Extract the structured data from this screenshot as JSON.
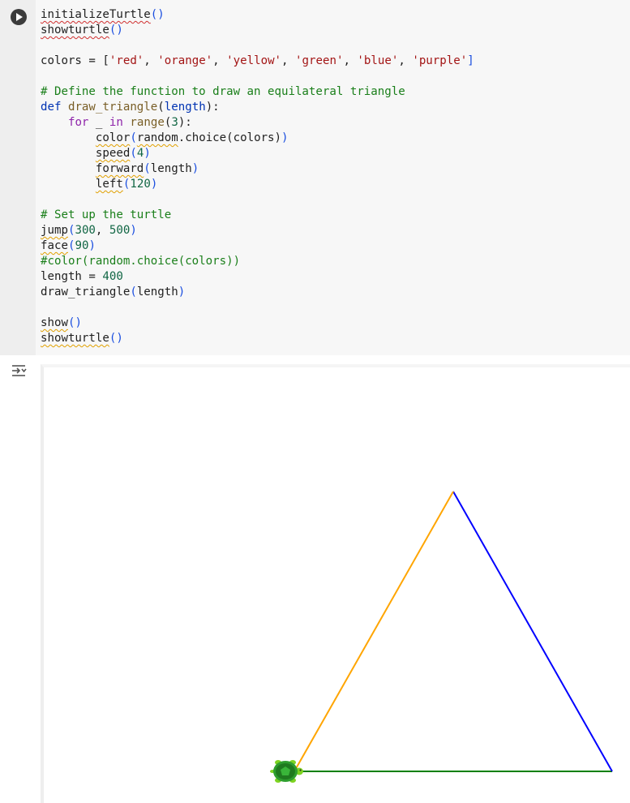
{
  "code_cell": {
    "run_button_label": "Run cell",
    "lines": [
      [
        {
          "t": "initializeTurtle",
          "c": "sqr"
        },
        {
          "t": "()",
          "c": "pr"
        }
      ],
      [
        {
          "t": "showturtle",
          "c": "sqr"
        },
        {
          "t": "()",
          "c": "pr"
        }
      ],
      [],
      [
        {
          "t": "colors = [",
          "c": ""
        },
        {
          "t": "'red'",
          "c": "st"
        },
        {
          "t": ", ",
          "c": ""
        },
        {
          "t": "'orange'",
          "c": "st"
        },
        {
          "t": ", ",
          "c": ""
        },
        {
          "t": "'yellow'",
          "c": "st"
        },
        {
          "t": ", ",
          "c": ""
        },
        {
          "t": "'green'",
          "c": "st"
        },
        {
          "t": ", ",
          "c": ""
        },
        {
          "t": "'blue'",
          "c": "st"
        },
        {
          "t": ", ",
          "c": ""
        },
        {
          "t": "'purple'",
          "c": "st"
        },
        {
          "t": "]",
          "c": "pr"
        }
      ],
      [],
      [
        {
          "t": "# Define the function to draw an equilateral triangle",
          "c": "cm"
        }
      ],
      [
        {
          "t": "def ",
          "c": "kw"
        },
        {
          "t": "draw_triangle",
          "c": "fn"
        },
        {
          "t": "(",
          "c": ""
        },
        {
          "t": "length",
          "c": "kw"
        },
        {
          "t": "):",
          "c": ""
        }
      ],
      [
        {
          "t": "    ",
          "c": ""
        },
        {
          "t": "for",
          "c": "kwp"
        },
        {
          "t": " _ ",
          "c": ""
        },
        {
          "t": "in",
          "c": "kwp"
        },
        {
          "t": " ",
          "c": ""
        },
        {
          "t": "range",
          "c": "fn"
        },
        {
          "t": "(",
          "c": ""
        },
        {
          "t": "3",
          "c": "nm"
        },
        {
          "t": "):",
          "c": ""
        }
      ],
      [
        {
          "t": "        ",
          "c": ""
        },
        {
          "t": "color",
          "c": "sq"
        },
        {
          "t": "(",
          "c": "pr"
        },
        {
          "t": "random",
          "c": "sq"
        },
        {
          "t": ".choice(colors)",
          "c": ""
        },
        {
          "t": ")",
          "c": "pr"
        }
      ],
      [
        {
          "t": "        ",
          "c": ""
        },
        {
          "t": "speed",
          "c": "sq"
        },
        {
          "t": "(",
          "c": "pr"
        },
        {
          "t": "4",
          "c": "nm"
        },
        {
          "t": ")",
          "c": "pr"
        }
      ],
      [
        {
          "t": "        ",
          "c": ""
        },
        {
          "t": "forward",
          "c": "sq"
        },
        {
          "t": "(",
          "c": "pr"
        },
        {
          "t": "length",
          "c": ""
        },
        {
          "t": ")",
          "c": "pr"
        }
      ],
      [
        {
          "t": "        ",
          "c": ""
        },
        {
          "t": "left",
          "c": "sq"
        },
        {
          "t": "(",
          "c": "pr"
        },
        {
          "t": "120",
          "c": "nm"
        },
        {
          "t": ")",
          "c": "pr"
        }
      ],
      [],
      [
        {
          "t": "# Set up the turtle",
          "c": "cm"
        }
      ],
      [
        {
          "t": "jump",
          "c": "sq"
        },
        {
          "t": "(",
          "c": "pr"
        },
        {
          "t": "300",
          "c": "nm"
        },
        {
          "t": ", ",
          "c": ""
        },
        {
          "t": "500",
          "c": "nm"
        },
        {
          "t": ")",
          "c": "pr"
        }
      ],
      [
        {
          "t": "face",
          "c": "sq"
        },
        {
          "t": "(",
          "c": "pr"
        },
        {
          "t": "90",
          "c": "nm"
        },
        {
          "t": ")",
          "c": "pr"
        }
      ],
      [
        {
          "t": "#color(random.choice(colors))",
          "c": "cm"
        }
      ],
      [
        {
          "t": "length = ",
          "c": ""
        },
        {
          "t": "400",
          "c": "nm"
        }
      ],
      [
        {
          "t": "draw_triangle",
          "c": ""
        },
        {
          "t": "(",
          "c": "pr"
        },
        {
          "t": "length",
          "c": ""
        },
        {
          "t": ")",
          "c": "pr"
        }
      ],
      [],
      [
        {
          "t": "show",
          "c": "sq"
        },
        {
          "t": "()",
          "c": "pr"
        }
      ],
      [
        {
          "t": "showturtle",
          "c": "sq"
        },
        {
          "t": "()",
          "c": "pr"
        }
      ]
    ]
  },
  "output": {
    "toggle_icon": "output-collapse-icon",
    "turtle_icon": "turtle-icon",
    "segments": [
      {
        "color": "#008000"
      },
      {
        "color": "#0000ff"
      },
      {
        "color": "#ffa500"
      }
    ]
  }
}
